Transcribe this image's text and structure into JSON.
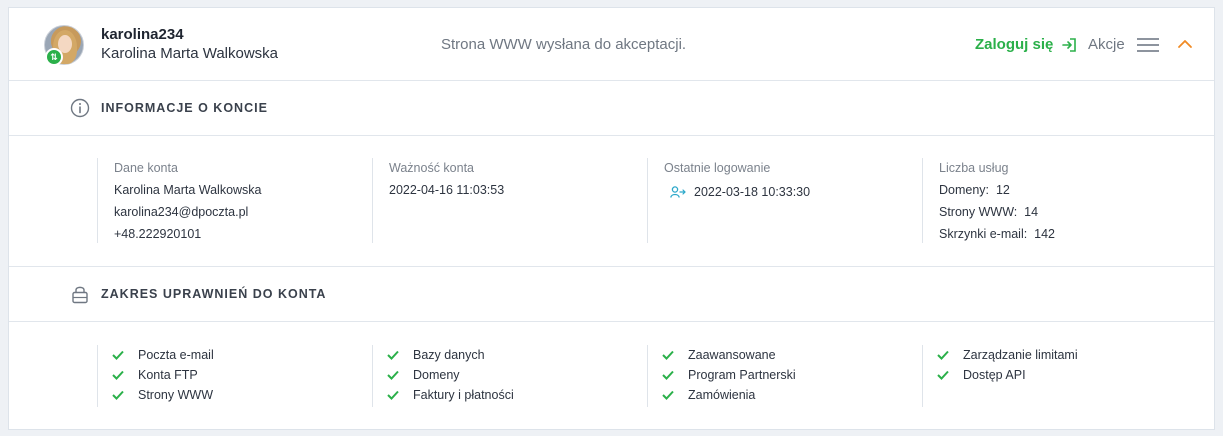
{
  "account": {
    "username": "karolina234",
    "full_name": "Karolina Marta Walkowska",
    "status_message": "Strona WWW wysłana do akceptacji.",
    "login_label": "Zaloguj się",
    "actions_label": "Akcje"
  },
  "colors": {
    "accent_green": "#2bb04a",
    "accent_orange": "#f08a24",
    "muted_text": "#7b828c"
  },
  "info_section": {
    "title": "INFORMACJE O KONCIE",
    "columns": [
      {
        "title": "Dane konta",
        "lines": [
          "Karolina Marta Walkowska",
          "karolina234@dpoczta.pl",
          "+48.222920101"
        ]
      },
      {
        "title": "Ważność konta",
        "lines": [
          "2022-04-16 11:03:53"
        ]
      },
      {
        "title": "Ostatnie logowanie",
        "lines": [
          "2022-03-18 10:33:30"
        ]
      },
      {
        "title": "Liczba usług",
        "lines": [
          "Domeny:  12",
          "Strony WWW:  14",
          "Skrzynki e-mail:  142"
        ]
      }
    ]
  },
  "permissions_section": {
    "title": "ZAKRES UPRAWNIEŃ DO KONTA",
    "columns": [
      [
        "Poczta e-mail",
        "Konta FTP",
        "Strony WWW"
      ],
      [
        "Bazy danych",
        "Domeny",
        "Faktury i płatności"
      ],
      [
        "Zaawansowane",
        "Program Partnerski",
        "Zamówienia"
      ],
      [
        "Zarządzanie limitami",
        "Dostęp API"
      ]
    ]
  },
  "icons": {
    "info": "info-circle-icon",
    "lock": "lock-icon",
    "login": "login-arrow-icon",
    "menu": "hamburger-icon",
    "collapse": "chevron-up-icon",
    "check": "check-icon",
    "last_login": "user-login-icon",
    "avatar_badge": "sync-badge-icon"
  }
}
